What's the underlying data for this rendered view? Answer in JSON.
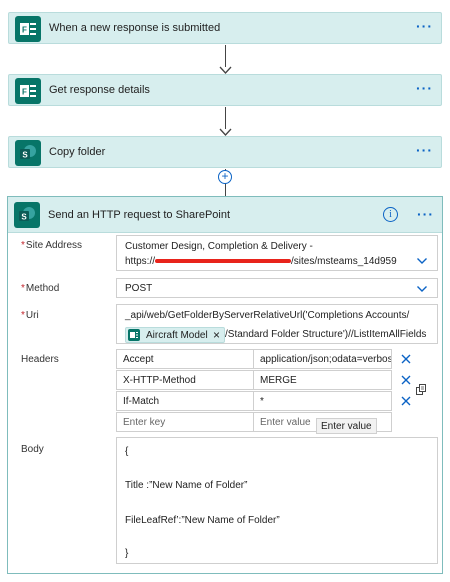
{
  "steps": [
    {
      "title": "When a new response is submitted",
      "icon": "forms-icon",
      "color": "#077568"
    },
    {
      "title": "Get response details",
      "icon": "forms-icon",
      "color": "#077568"
    },
    {
      "title": "Copy folder",
      "icon": "sharepoint-icon",
      "color": "#077568"
    }
  ],
  "more_label": "···",
  "action": {
    "title": "Send an HTTP request to SharePoint",
    "info_label": "i",
    "site_address": {
      "label": "Site Address",
      "line1": "Customer Design, Completion & Delivery -",
      "line2_prefix": "https://",
      "line2_suffix": "/sites/msteams_14d959"
    },
    "method": {
      "label": "Method",
      "value": "POST"
    },
    "uri": {
      "label": "Uri",
      "line1": "_api/web/GetFolderByServerRelativeUrl('Completions Accounts/",
      "token": "Aircraft Model",
      "token_close": "×",
      "line2": "/Standard Folder Structure')//ListItemAllFields"
    },
    "headers": {
      "label": "Headers",
      "rows": [
        {
          "key": "Accept",
          "value": "application/json;odata=verbose"
        },
        {
          "key": "X-HTTP-Method",
          "value": "MERGE"
        },
        {
          "key": "If-Match",
          "value": "*"
        }
      ],
      "key_placeholder": "Enter key",
      "value_placeholder": "Enter value",
      "tooltip": "Enter value"
    },
    "body": {
      "label": "Body",
      "lines": [
        "{",
        "Title :”New Name of Folder”",
        "FileLeafRef’:”New Name of Folder”",
        "}"
      ]
    }
  },
  "colors": {
    "header_bg": "#d7eeee",
    "icon_bg": "#077568",
    "accent": "#0b63c5",
    "required": "#c4262e",
    "redaction": "#e8231b"
  }
}
